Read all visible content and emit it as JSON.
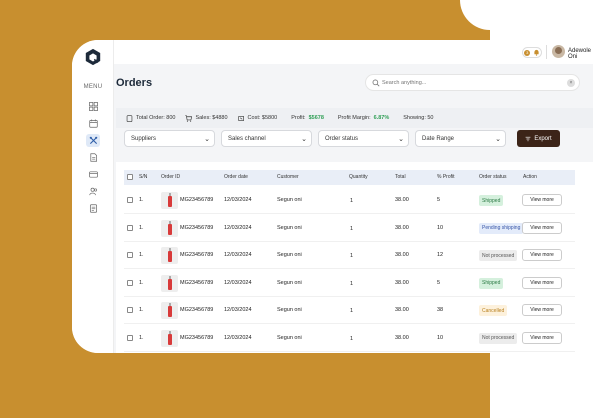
{
  "user": {
    "name": "Adewole Oni",
    "notif_count": "3"
  },
  "sidebar": {
    "menu_label": "MENU",
    "items": [
      "dashboard-icon",
      "calendar-icon",
      "tools-icon",
      "document-icon",
      "card-icon",
      "users-icon",
      "report-icon"
    ],
    "active": "tools-icon"
  },
  "page": {
    "title": "Orders"
  },
  "search": {
    "placeholder": "Search anything..."
  },
  "stats": {
    "total_order": "Total Order: 800",
    "sales": "Sales: $4880",
    "cost": "Cost: $5800",
    "profit_label": "Profit:",
    "profit_value": "$5678",
    "margin_label": "Profit Margin:",
    "margin_value": "6.87%",
    "showing": "Showing: 50"
  },
  "filters": [
    "Suppliers",
    "Sales channel",
    "Order status",
    "Date Range"
  ],
  "export_label": "Export",
  "table": {
    "headers": [
      "S/N",
      "Order ID",
      "Order date",
      "Customer",
      "Quantity",
      "Total",
      "% Profit",
      "Order status",
      "Action"
    ],
    "rows": [
      {
        "sn": "1.",
        "id": "MG23456789",
        "date": "12/03/2024",
        "customer": "Segun oni",
        "qty": "1",
        "total": "38.00",
        "profit": "5",
        "status": "Shipped",
        "action": "View more"
      },
      {
        "sn": "1.",
        "id": "MG23456789",
        "date": "12/03/2024",
        "customer": "Segun oni",
        "qty": "1",
        "total": "38.00",
        "profit": "10",
        "status": "Pending shipping",
        "action": "View more"
      },
      {
        "sn": "1.",
        "id": "MG23456789",
        "date": "12/03/2024",
        "customer": "Segun oni",
        "qty": "1",
        "total": "38.00",
        "profit": "12",
        "status": "Not processed",
        "action": "View more"
      },
      {
        "sn": "1.",
        "id": "MG23456789",
        "date": "12/03/2024",
        "customer": "Segun oni",
        "qty": "1",
        "total": "38.00",
        "profit": "5",
        "status": "Shipped",
        "action": "View more"
      },
      {
        "sn": "1.",
        "id": "MG23456789",
        "date": "12/03/2024",
        "customer": "Segun oni",
        "qty": "1",
        "total": "38.00",
        "profit": "38",
        "status": "Cancelled",
        "action": "View more"
      },
      {
        "sn": "1.",
        "id": "MG23456789",
        "date": "12/03/2024",
        "customer": "Segun oni",
        "qty": "1",
        "total": "38.00",
        "profit": "10",
        "status": "Not processed",
        "action": "View more"
      }
    ]
  },
  "status_colors": {
    "Shipped": {
      "bg": "#d5f0dd",
      "fg": "#2c7a45"
    },
    "Pending shipping": {
      "bg": "#e3ebfa",
      "fg": "#3856a8"
    },
    "Not processed": {
      "bg": "#ececec",
      "fg": "#555555"
    },
    "Cancelled": {
      "bg": "#fdf1dc",
      "fg": "#b8801f"
    }
  },
  "colors": {
    "brand_dark": "#3c2418",
    "gold": "#c88f2f"
  }
}
